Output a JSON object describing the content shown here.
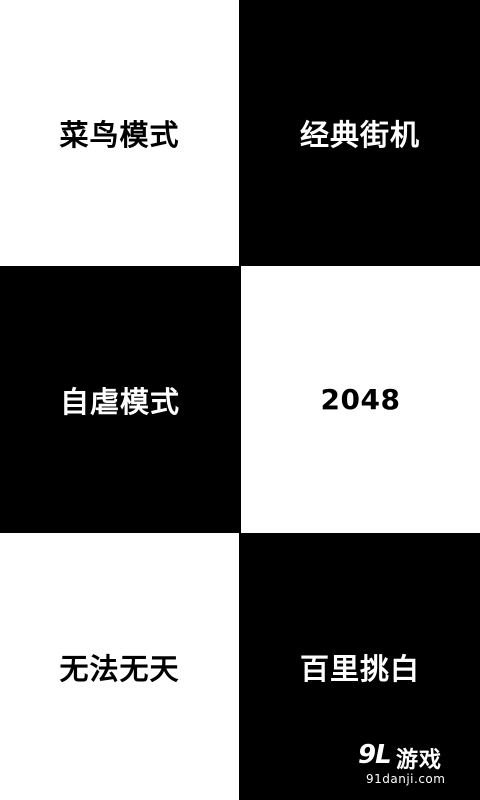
{
  "modes": [
    {
      "label": "菜鸟模式"
    },
    {
      "label": "经典街机"
    },
    {
      "label": "自虐模式"
    },
    {
      "label": "2048"
    },
    {
      "label": "无法无天"
    },
    {
      "label": "百里挑白"
    }
  ],
  "watermark": {
    "logo": "9L",
    "brand": "游戏",
    "url": "91danji.com"
  },
  "colors": {
    "dark_tile": "#000000",
    "light_tile": "#ffffff"
  }
}
